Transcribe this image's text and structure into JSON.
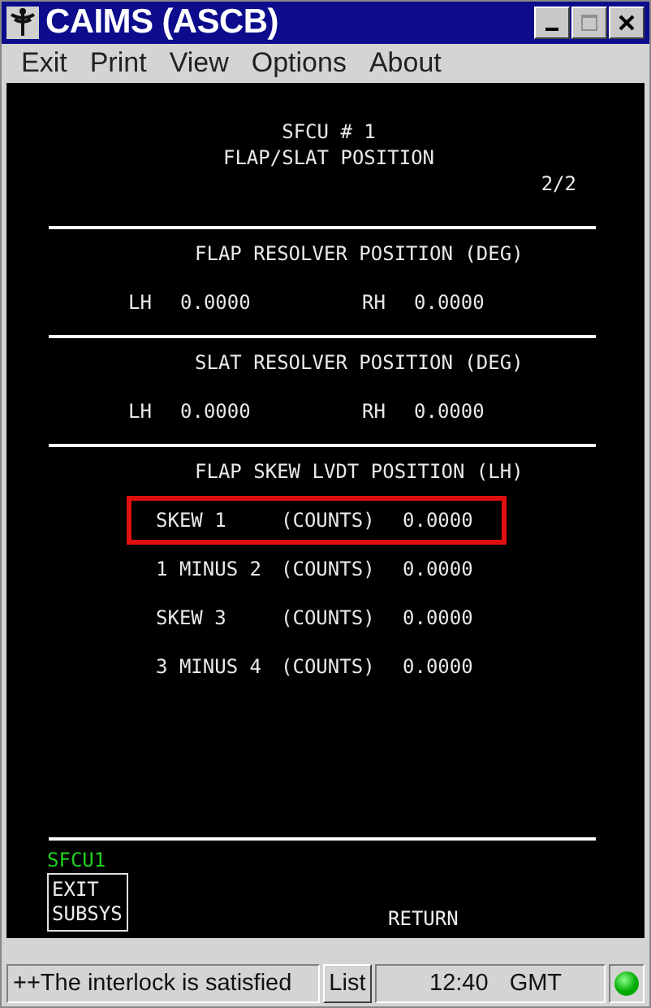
{
  "window": {
    "title": "CAIMS (ASCB)",
    "controls": [
      {
        "kind": "minimize",
        "disabled": false
      },
      {
        "kind": "maximize",
        "disabled": true
      },
      {
        "kind": "close",
        "disabled": false
      }
    ]
  },
  "menu": [
    "Exit",
    "Print",
    "View",
    "Options",
    "About"
  ],
  "screen": {
    "unit": "SFCU # 1",
    "title": "FLAP/SLAT POSITION",
    "page": "2/2",
    "sections": [
      {
        "heading": "FLAP RESOLVER POSITION (DEG)",
        "kind": "pair",
        "items": [
          {
            "label": "LH",
            "value": "0.0000"
          },
          {
            "label": "RH",
            "value": "0.0000"
          }
        ]
      },
      {
        "heading": "SLAT RESOLVER POSITION (DEG)",
        "kind": "pair",
        "items": [
          {
            "label": "LH",
            "value": "0.0000"
          },
          {
            "label": "RH",
            "value": "0.0000"
          }
        ]
      },
      {
        "heading": "FLAP SKEW LVDT POSITION (LH)",
        "kind": "list",
        "items": [
          {
            "label": "SKEW 1",
            "unit": "(COUNTS)",
            "value": "0.0000",
            "highlighted": true
          },
          {
            "label": "1 MINUS 2",
            "unit": "(COUNTS)",
            "value": "0.0000",
            "highlighted": false
          },
          {
            "label": "SKEW 3",
            "unit": "(COUNTS)",
            "value": "0.0000",
            "highlighted": false
          },
          {
            "label": "3 MINUS 4",
            "unit": "(COUNTS)",
            "value": "0.0000",
            "highlighted": false
          }
        ]
      }
    ],
    "subsystem": "SFCU1",
    "exit_button": "EXIT SUBSYS",
    "return_button": "RETURN"
  },
  "status_bar": {
    "message": "++The interlock is satisfied",
    "list_button": "List",
    "time": "12:40",
    "zone": "GMT",
    "indicator_on": true
  }
}
